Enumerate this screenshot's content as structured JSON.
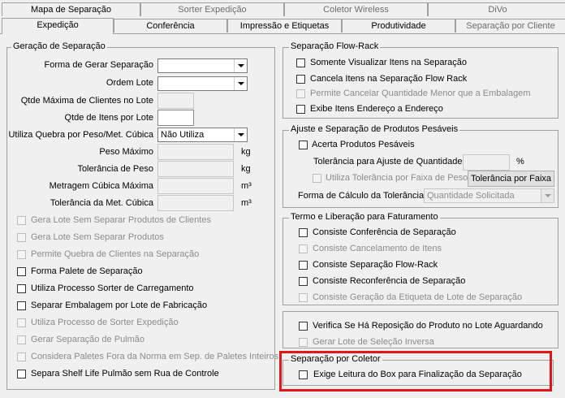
{
  "tabs_row1": [
    "Mapa de Separação",
    "Sorter Expedição",
    "Coletor Wireless",
    "DiVo"
  ],
  "tabs_row2": [
    "Expedição",
    "Conferência",
    "Impressão e Etiquetas",
    "Produtividade",
    "Separação por Cliente"
  ],
  "geracao": {
    "title": "Geração de Separação",
    "forma_label": "Forma de Gerar Separação",
    "ordem_label": "Ordem Lote",
    "qtde_max_label": "Qtde Máxima de Clientes no Lote",
    "qtde_itens_label": "Qtde de Itens por Lote",
    "quebra_label": "Utiliza Quebra por Peso/Met. Cúbica",
    "quebra_value": "Não Utiliza",
    "peso_max_label": "Peso Máximo",
    "peso_unit": "kg",
    "tol_peso_label": "Tolerância de Peso",
    "tol_peso_unit": "kg",
    "metragem_label": "Metragem Cúbica Máxima",
    "metragem_unit": "m³",
    "tol_met_label": "Tolerância da Met. Cúbica",
    "tol_met_unit": "m³",
    "checks": [
      {
        "label": "Gera Lote Sem Separar Produtos de Clientes",
        "enabled": false
      },
      {
        "label": "Gera Lote Sem Separar Produtos",
        "enabled": false
      },
      {
        "label": "Permite Quebra de Clientes na Separação",
        "enabled": false
      },
      {
        "label": "Forma Palete de Separação",
        "enabled": true
      },
      {
        "label": "Utiliza Processo Sorter de Carregamento",
        "enabled": true
      },
      {
        "label": "Separar Embalagem por Lote de Fabricação",
        "enabled": true
      },
      {
        "label": "Utiliza Processo de Sorter Expedição",
        "enabled": false
      },
      {
        "label": "Gerar Separação de Pulmão",
        "enabled": false
      },
      {
        "label": "Considera Paletes Fora da Norma em Sep. de Paletes Inteiros",
        "enabled": false
      },
      {
        "label": "Separa Shelf Life Pulmão sem Rua de Controle",
        "enabled": true
      }
    ]
  },
  "flowrack": {
    "title": "Separação Flow-Rack",
    "checks": [
      {
        "label": "Somente Visualizar Itens na Separação",
        "enabled": true
      },
      {
        "label": "Cancela Itens na Separação Flow Rack",
        "enabled": true
      },
      {
        "label": "Permite Cancelar Quantidade Menor que a Embalagem",
        "enabled": false
      },
      {
        "label": "Exibe Itens Endereço a Endereço",
        "enabled": true
      }
    ]
  },
  "pesaveis": {
    "title": "Ajuste e Separação de Produtos Pesáveis",
    "acerta_label": "Acerta Produtos Pesáveis",
    "tolerancia_label": "Tolerância para Ajuste de Quantidade",
    "percent": "%",
    "faixa_label": "Utiliza Tolerância por Faixa de Peso",
    "faixa_button": "Tolerância por Faixa",
    "forma_label": "Forma de Cálculo da Tolerância",
    "forma_value": "Quantidade Solicitada"
  },
  "termo": {
    "title": "Termo e Liberação para Faturamento",
    "checks": [
      {
        "label": "Consiste Conferência de Separação",
        "enabled": true
      },
      {
        "label": "Consiste Cancelamento de Itens",
        "enabled": false
      },
      {
        "label": "Consiste Separação Flow-Rack",
        "enabled": true
      },
      {
        "label": "Consiste Reconferência de Separação",
        "enabled": true
      },
      {
        "label": "Consiste Geração da Etiqueta de Lote de Separação",
        "enabled": false
      }
    ]
  },
  "reposicao": {
    "checks": [
      {
        "label": "Verifica Se Há Reposição do Produto no Lote Aguardando",
        "enabled": true
      },
      {
        "label": "Gerar Lote de Seleção Inversa",
        "enabled": false
      }
    ]
  },
  "coletor": {
    "title": "Separação por Coletor",
    "check_label": "Exige Leitura do Box para Finalização da Separação"
  },
  "highlight_color": "#e0181c"
}
